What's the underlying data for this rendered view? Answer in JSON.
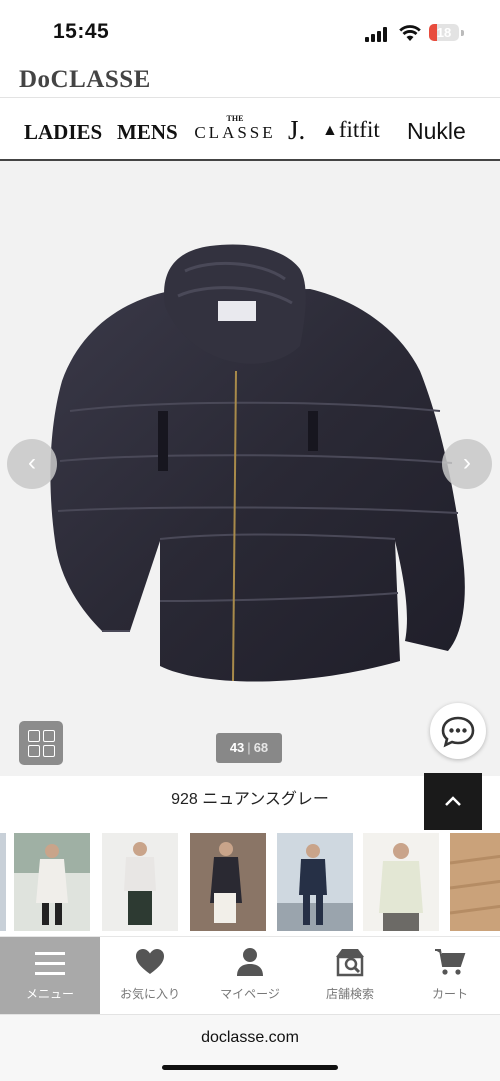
{
  "status": {
    "time": "15:45",
    "battery": "18"
  },
  "site": {
    "logo": "DoCLASSE"
  },
  "brands": {
    "ladies": "LADIES",
    "mens": "MENS",
    "classe_the": "THE",
    "classe": "CLASSE",
    "j": "J.",
    "fitfit": "fitfit",
    "nukle": "Nukle"
  },
  "gallery": {
    "current": "43",
    "separator": "|",
    "total": "68",
    "prev_icon": "chevron-left-icon",
    "next_icon": "chevron-right-icon"
  },
  "product": {
    "color_name": "928 ニュアンスグレー"
  },
  "thumbnails": [
    {
      "label": "thumb-1"
    },
    {
      "label": "thumb-2"
    },
    {
      "label": "thumb-3"
    },
    {
      "label": "thumb-4"
    },
    {
      "label": "thumb-5"
    },
    {
      "label": "thumb-6"
    },
    {
      "label": "thumb-7"
    }
  ],
  "bottom_nav": [
    {
      "label": "メニュー",
      "icon": "hamburger-icon",
      "active": true
    },
    {
      "label": "お気に入り",
      "icon": "heart-icon"
    },
    {
      "label": "マイページ",
      "icon": "person-icon"
    },
    {
      "label": "店舗検索",
      "icon": "store-search-icon"
    },
    {
      "label": "カート",
      "icon": "cart-icon"
    }
  ],
  "browser": {
    "url": "doclasse.com"
  },
  "colors": {
    "accent_dark": "#1a1a1a",
    "jacket": "#2b2a38",
    "background": "#f2f2f2"
  }
}
